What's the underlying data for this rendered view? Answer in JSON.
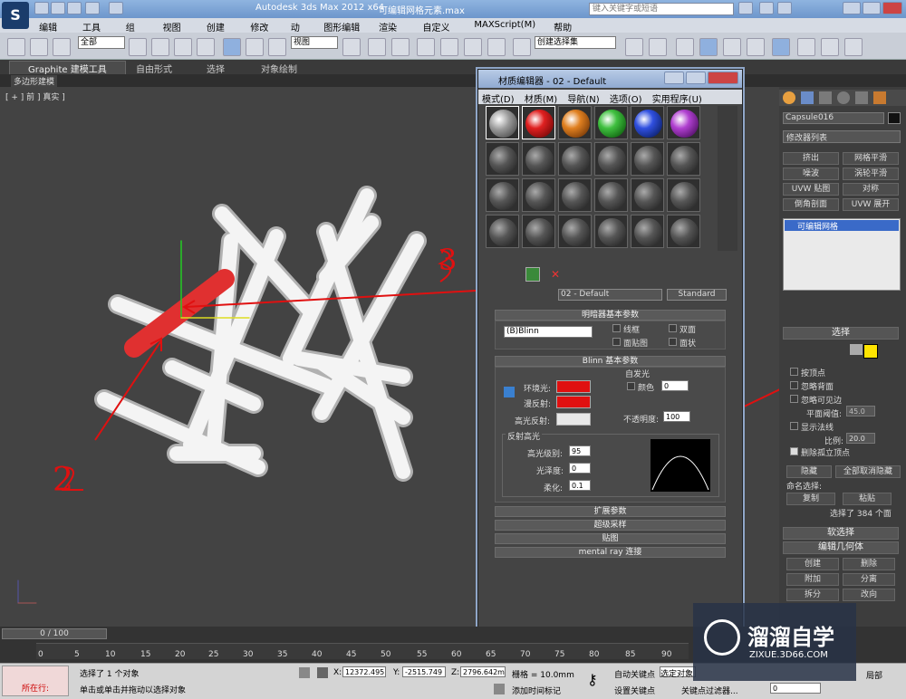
{
  "window": {
    "title": "Autodesk 3ds Max  2012 x64",
    "file": "可编辑网格元素.max",
    "search_placeholder": "键入关键字或短语"
  },
  "menu": [
    "编辑(E)",
    "工具(T)",
    "组(G)",
    "视图(V)",
    "创建(C)",
    "修改器",
    "动画",
    "图形编辑器",
    "渲染(R)",
    "自定义(U)",
    "MAXScript(M)",
    "帮助(H)"
  ],
  "toolbar": {
    "selection_filter": "全部",
    "view_dropdown": "视图",
    "named_selection": "创建选择集"
  },
  "ribbon": {
    "tabs": [
      "Graphite 建模工具",
      "自由形式",
      "选择",
      "对象绘制"
    ],
    "sub": "多边形建模"
  },
  "viewport": {
    "label": "[ + ] 前 ] 真实 ]"
  },
  "material_editor": {
    "title": "材质编辑器 - 02 - Default",
    "menu": [
      "模式(D)",
      "材质(M)",
      "导航(N)",
      "选项(O)",
      "实用程序(U)"
    ],
    "material_name": "02 - Default",
    "material_type": "Standard",
    "shader_header": "明暗器基本参数",
    "shader": "(B)Blinn",
    "shader_opts": [
      "线框",
      "双面",
      "面贴图",
      "面状"
    ],
    "blinn_header": "Blinn 基本参数",
    "self_illum": "自发光",
    "color_label": "颜色",
    "color_value": "0",
    "ambient": "环境光:",
    "diffuse": "漫反射:",
    "specular": "高光反射:",
    "opacity_label": "不透明度:",
    "opacity_value": "100",
    "spec_header": "反射高光",
    "spec_level_label": "高光级别:",
    "spec_level": "95",
    "gloss_label": "光泽度:",
    "gloss": "0",
    "soften_label": "柔化:",
    "soften": "0.1",
    "rollouts": [
      "扩展参数",
      "超级采样",
      "贴图",
      "mental ray 连接"
    ],
    "ambient_color": "#e01010",
    "diffuse_color": "#e01010",
    "specular_color": "#e8e8e8"
  },
  "command_panel": {
    "object_name": "Capsule016",
    "modifier_list": "修改器列表",
    "buttons": [
      "挤出",
      "网格平滑",
      "噪波",
      "涡轮平滑",
      "UVW 贴图",
      "对称",
      "倒角剖面",
      "UVW 展开"
    ],
    "stack_item": "可编辑网格",
    "select_header": "选择",
    "by_vertex": "按顶点",
    "ignore_back": "忽略背面",
    "ignore_visible": "忽略可见边",
    "planar_label": "平面阈值:",
    "planar_value": "45.0",
    "show_normals": "显示法线",
    "scale_label": "比例:",
    "scale_value": "20.0",
    "delete_isolated": "删除孤立顶点",
    "hide": "隐藏",
    "unhide_all": "全部取消隐藏",
    "named_sel": "命名选择:",
    "copy": "复制",
    "paste": "粘贴",
    "selected_info": "选择了 384 个面",
    "soft_sel": "软选择",
    "edit_geom": "编辑几何体",
    "create": "创建",
    "delete": "删除",
    "attach": "附加",
    "detach": "分离",
    "split": "拆分",
    "turn": "改向"
  },
  "timeline": {
    "frame": "0 / 100",
    "ticks": [
      "0",
      "5",
      "10",
      "15",
      "20",
      "25",
      "30",
      "35",
      "40",
      "45",
      "50",
      "55",
      "60",
      "65",
      "70",
      "75",
      "80",
      "85",
      "90"
    ]
  },
  "status": {
    "running": "所在行:",
    "msg1": "选择了 1 个对象",
    "msg2": "单击或单击并拖动以选择对象",
    "x_label": "X:",
    "x": "12372.495",
    "y_label": "Y:",
    "y": "-2515.749",
    "z_label": "Z:",
    "z": "2796.642m",
    "grid": "栅格 = 10.0mm",
    "add_time_tag": "添加时间标记",
    "auto_key": "自动关键点",
    "set_key": "设置关键点",
    "selected": "选定对象",
    "key_filters": "关键点过滤器...",
    "frame_value": "0",
    "local": "局部"
  },
  "watermark": {
    "name": "溜溜自学",
    "url": "ZIXUE.3D66.COM"
  },
  "annotations": [
    "2",
    "3"
  ]
}
